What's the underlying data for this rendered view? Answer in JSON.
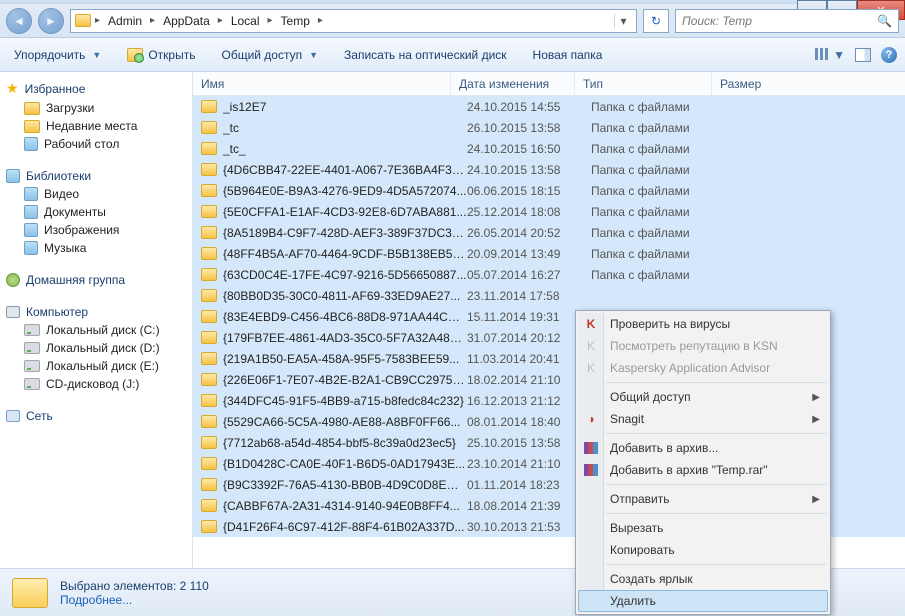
{
  "breadcrumb": [
    "Admin",
    "AppData",
    "Local",
    "Temp"
  ],
  "search": {
    "placeholder": "Поиск: Temp"
  },
  "toolbar": {
    "organize": "Упорядочить",
    "open": "Открыть",
    "share": "Общий доступ",
    "burn": "Записать на оптический диск",
    "newfolder": "Новая папка"
  },
  "columns": {
    "name": "Имя",
    "date": "Дата изменения",
    "type": "Тип",
    "size": "Размер"
  },
  "sidebar": {
    "favorites": "Избранное",
    "downloads": "Загрузки",
    "recent": "Недавние места",
    "desktop": "Рабочий стол",
    "libraries": "Библиотеки",
    "video": "Видео",
    "documents": "Документы",
    "pictures": "Изображения",
    "music": "Музыка",
    "homegroup": "Домашняя группа",
    "computer": "Компьютер",
    "drive_c": "Локальный диск (C:)",
    "drive_d": "Локальный диск (D:)",
    "drive_e": "Локальный диск (E:)",
    "cd_j": "CD-дисковод (J:)",
    "network": "Сеть"
  },
  "type_folder": "Папка с файлами",
  "files": [
    {
      "n": "_is12E7",
      "d": "24.10.2015 14:55"
    },
    {
      "n": "_tc",
      "d": "26.10.2015 13:58"
    },
    {
      "n": "_tc_",
      "d": "24.10.2015 16:50"
    },
    {
      "n": "{4D6CBB47-22EE-4401-A067-7E36BA4F37...",
      "d": "24.10.2015 13:58"
    },
    {
      "n": "{5B964E0E-B9A3-4276-9ED9-4D5A572074...",
      "d": "06.06.2015 18:15"
    },
    {
      "n": "{5E0CFFA1-E1AF-4CD3-92E8-6D7ABA881...",
      "d": "25.12.2014 18:08"
    },
    {
      "n": "{8A5189B4-C9F7-428D-AEF3-389F37DC34...",
      "d": "26.05.2014 20:52"
    },
    {
      "n": "{48FF4B5A-AF70-4464-9CDF-B5B138EB5B...",
      "d": "20.09.2014 13:49"
    },
    {
      "n": "{63CD0C4E-17FE-4C97-9216-5D56650887...",
      "d": "05.07.2014 16:27"
    },
    {
      "n": "{80BB0D35-30C0-4811-AF69-33ED9AE27...",
      "d": "23.11.2014 17:58"
    },
    {
      "n": "{83E4EBD9-C456-4BC6-88D8-971AA44CC2...",
      "d": "15.11.2014 19:31"
    },
    {
      "n": "{179FB7EE-4861-4AD3-35C0-5F7A32A48E...",
      "d": "31.07.2014 20:12"
    },
    {
      "n": "{219A1B50-EA5A-458A-95F5-7583BEE59...",
      "d": "11.03.2014 20:41"
    },
    {
      "n": "{226E06F1-7E07-4B2E-B2A1-CB9CC29754...",
      "d": "18.02.2014 21:10"
    },
    {
      "n": "{344DFC45-91F5-4BB9-a715-b8fedc84c232}",
      "d": "16.12.2013 21:12"
    },
    {
      "n": "{5529CA66-5C5A-4980-AE88-A8BF0FF66...",
      "d": "08.01.2014 18:40"
    },
    {
      "n": "{7712ab68-a54d-4854-bbf5-8c39a0d23ec5}",
      "d": "25.10.2015 13:58"
    },
    {
      "n": "{B1D0428C-CA0E-40F1-B6D5-0AD17943E...",
      "d": "23.10.2014 21:10"
    },
    {
      "n": "{B9C3392F-76A5-4130-BB0B-4D9C0D8EC81...",
      "d": "01.11.2014 18:23"
    },
    {
      "n": "{CABBF67A-2A31-4314-9140-94E0B8FF4...",
      "d": "18.08.2014 21:39"
    },
    {
      "n": "{D41F26F4-6C97-412F-88F4-61B02A337D...",
      "d": "30.10.2013 21:53"
    }
  ],
  "details": {
    "line1": "Выбрано элементов: 2 110",
    "line2": "Подробнее..."
  },
  "context_menu": {
    "virus": "Проверить на вирусы",
    "ksn": "Посмотреть репутацию в KSN",
    "kaa": "Kaspersky Application Advisor",
    "share": "Общий доступ",
    "snagit": "Snagit",
    "archive": "Добавить в архив...",
    "archive_temp": "Добавить в архив \"Temp.rar\"",
    "send": "Отправить",
    "cut": "Вырезать",
    "copy": "Копировать",
    "shortcut": "Создать ярлык",
    "delete": "Удалить"
  }
}
